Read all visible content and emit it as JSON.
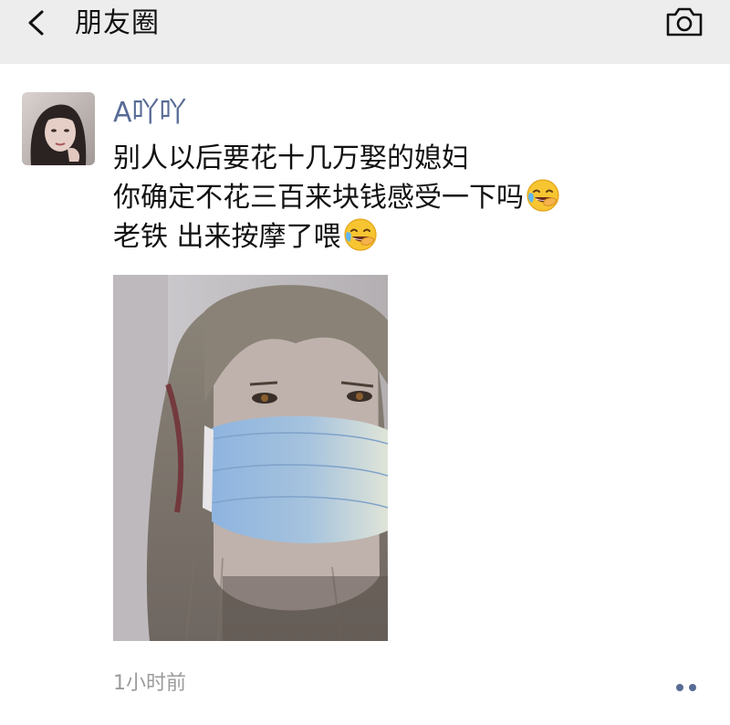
{
  "header": {
    "title": "朋友圈",
    "back_icon": "chevron-left-icon",
    "camera_icon": "camera-icon"
  },
  "post": {
    "username": "A吖吖",
    "text_lines": [
      "别人以后要花十几万娶的媳妇",
      "你确定不花三百来块钱感受一下吗",
      "老铁 出来按摩了喂"
    ],
    "emoji": "grinning-crying-emoji",
    "timestamp": "1小时前",
    "more_icon": "more-dots-icon"
  },
  "colors": {
    "header_bg": "#ededed",
    "username": "#576b95",
    "timestamp": "#9b9b9b",
    "text": "#111111"
  }
}
